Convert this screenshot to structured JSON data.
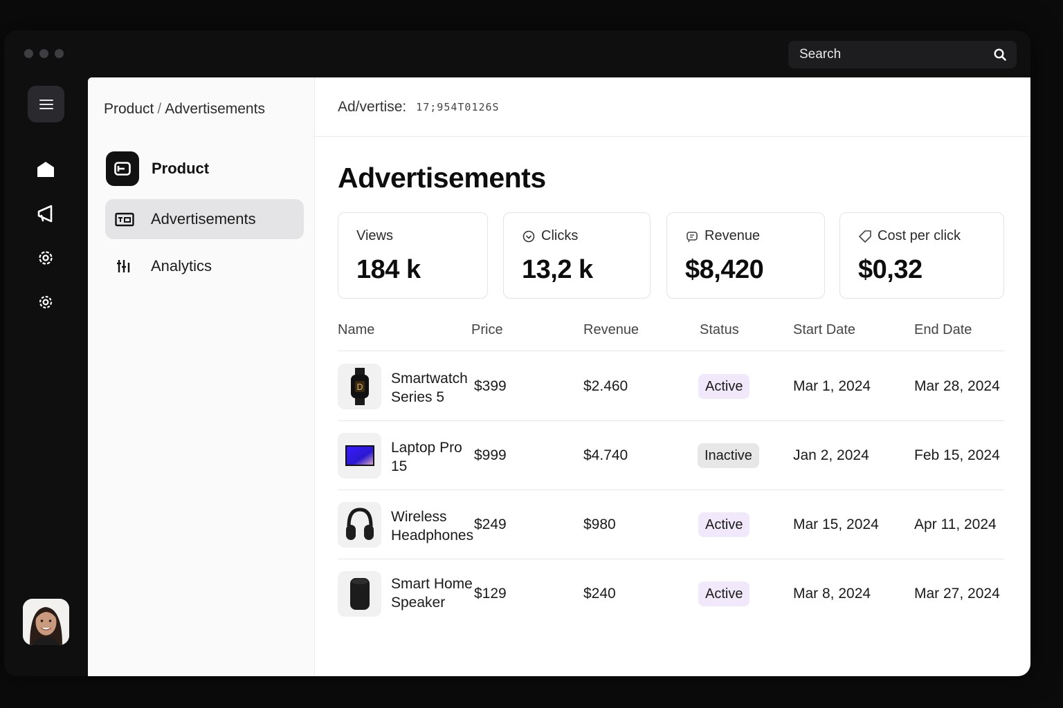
{
  "window": {
    "search_placeholder": "Search"
  },
  "breadcrumb": {
    "parent": "Product",
    "separator": "/",
    "current": "Advertisements"
  },
  "subnav": {
    "header": "Product",
    "items": [
      {
        "label": "Advertisements",
        "icon": "ad-icon",
        "active": true
      },
      {
        "label": "Analytics",
        "icon": "sliders-icon",
        "active": false
      }
    ]
  },
  "main": {
    "top_label": "Ad/vertise:",
    "top_code": "17;954T0126S",
    "title": "Advertisements"
  },
  "stats": [
    {
      "label": "Views",
      "value": "184 k",
      "icon": ""
    },
    {
      "label": "Clicks",
      "value": "13,2 k",
      "icon": "check-circle-icon"
    },
    {
      "label": "Revenue",
      "value": "$8,420",
      "icon": "revenue-icon"
    },
    {
      "label": "Cost per click",
      "value": "$0,32",
      "icon": "tag-icon"
    }
  ],
  "table": {
    "columns": [
      "Name",
      "Price",
      "Revenue",
      "Status",
      "Start Date",
      "End Date"
    ],
    "rows": [
      {
        "name": "Smartwatch Series 5",
        "thumb": "smartwatch",
        "price": "$399",
        "revenue": "$2.460",
        "status": "Active",
        "start": "Mar 1, 2024",
        "end": "Mar 28, 2024"
      },
      {
        "name": "Laptop Pro 15",
        "thumb": "laptop",
        "price": "$999",
        "revenue": "$4.740",
        "status": "Inactive",
        "start": "Jan 2, 2024",
        "end": "Feb 15, 2024"
      },
      {
        "name": "Wireless Headphones",
        "thumb": "headphones",
        "price": "$249",
        "revenue": "$980",
        "status": "Active",
        "start": "Mar 15, 2024",
        "end": "Apr 11, 2024"
      },
      {
        "name": "Smart Home Speaker",
        "thumb": "speaker",
        "price": "$129",
        "revenue": "$240",
        "status": "Active",
        "start": "Mar 8, 2024",
        "end": "Mar 27, 2024"
      }
    ]
  },
  "colors": {
    "active_badge": "#f1e9fb",
    "inactive_badge": "#e7e7e8",
    "rail_bg": "#0f0f10"
  }
}
